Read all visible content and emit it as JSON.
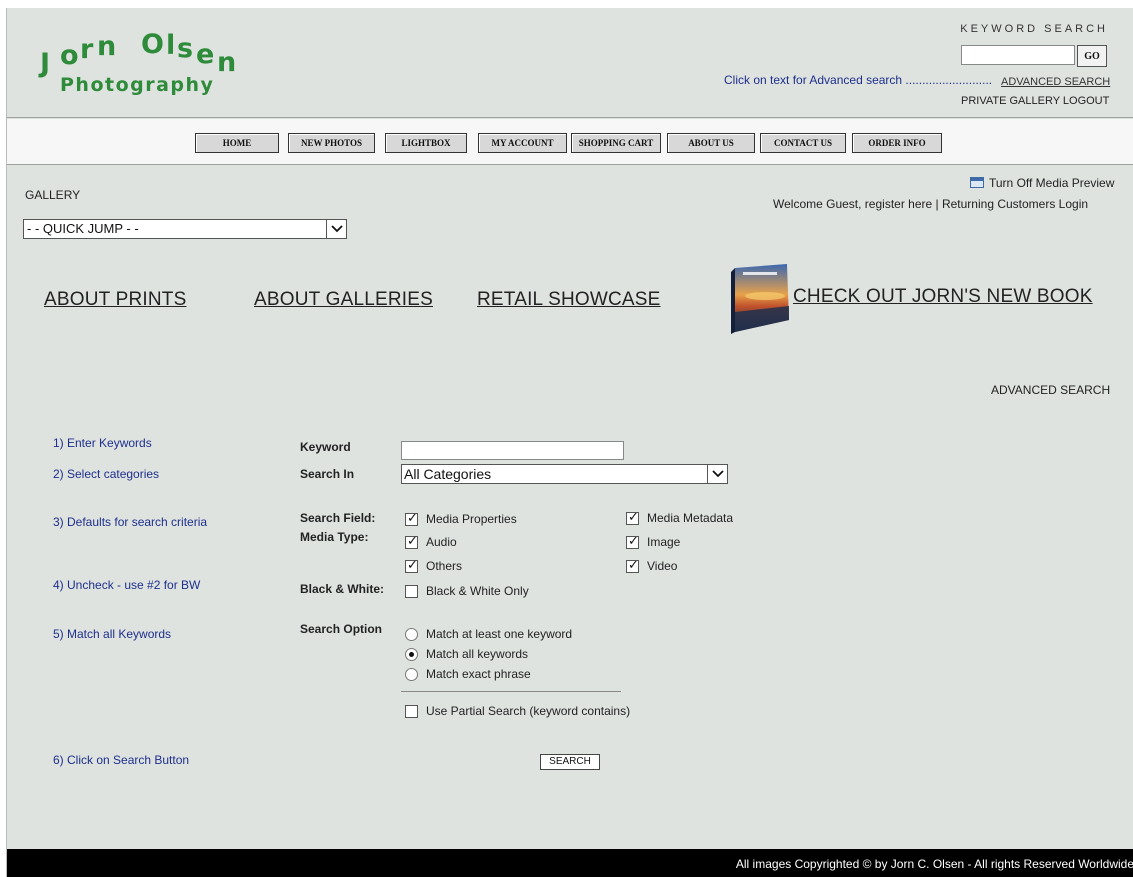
{
  "header": {
    "logo_line1": "Jorn Olsen",
    "logo_line2": "Photography",
    "keyword_search_title": "KEYWORD SEARCH",
    "keyword_value": "",
    "go_label": "GO",
    "advanced_hint": "Click on text for Advanced search ..........................",
    "advanced_link": "ADVANCED SEARCH",
    "logout_link": "PRIVATE GALLERY LOGOUT"
  },
  "nav": {
    "items": [
      {
        "label": "HOME"
      },
      {
        "label": "NEW PHOTOS"
      },
      {
        "label": "LIGHTBOX"
      },
      {
        "label": "MY ACCOUNT"
      },
      {
        "label": "SHOPPING CART"
      },
      {
        "label": "ABOUT US"
      },
      {
        "label": "CONTACT US"
      },
      {
        "label": "ORDER INFO"
      }
    ]
  },
  "content": {
    "gallery_label": "GALLERY",
    "quick_jump": "- - QUICK JUMP - -",
    "media_preview": "Turn Off Media Preview",
    "welcome": "Welcome Guest, register here | Returning Customers Login",
    "links": {
      "about_prints": "ABOUT PRINTS",
      "about_galleries": "ABOUT GALLERIES",
      "retail_showcase": "RETAIL SHOWCASE",
      "new_book": "CHECK OUT JORN'S NEW BOOK"
    },
    "advanced_heading": "ADVANCED SEARCH"
  },
  "form": {
    "steps": [
      "1) Enter Keywords",
      "2) Select categories",
      "3) Defaults for search criteria",
      "4) Uncheck - use #2 for BW",
      "5) Match all Keywords",
      "6) Click on Search Button"
    ],
    "labels": {
      "keyword": "Keyword",
      "search_in": "Search In",
      "search_field": "Search Field:",
      "media_type": "Media Type:",
      "black_white": "Black & White:",
      "search_option": "Search Option"
    },
    "keyword_value": "",
    "search_in_value": "All Categories",
    "search_field_opts": {
      "media_properties": "Media Properties",
      "media_metadata": "Media Metadata"
    },
    "media_type_opts": {
      "audio": "Audio",
      "image": "Image",
      "others": "Others",
      "video": "Video"
    },
    "bw_opt": "Black & White Only",
    "radio_opts": {
      "at_least_one": "Match at least one keyword",
      "all": "Match all keywords",
      "exact": "Match exact phrase"
    },
    "partial_search": "Use Partial Search (keyword contains)",
    "search_button": "SEARCH"
  },
  "footer": {
    "copyright": "All images Copyrighted © by Jorn C. Olsen - All rights Reserved Worldwide"
  }
}
